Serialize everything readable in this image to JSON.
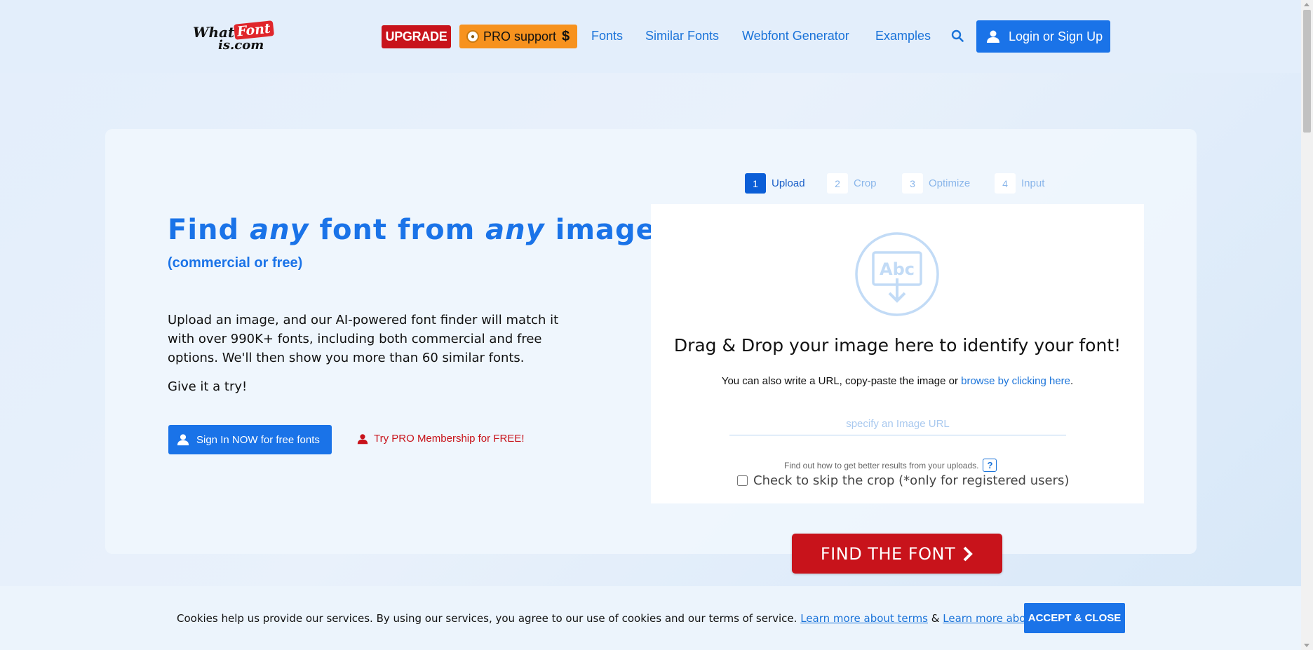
{
  "header": {
    "logo": {
      "what": "What",
      "font": "Font",
      "iscom": "is.com"
    },
    "upgrade_label": "UPGRADE",
    "pro_support_label": "PRO support",
    "pro_support_symbol": "$",
    "nav": [
      {
        "label": "Fonts"
      },
      {
        "label": "Similar Fonts"
      },
      {
        "label": "Webfont Generator"
      },
      {
        "label": "Examples"
      }
    ],
    "login_label": "Login or Sign Up"
  },
  "hero": {
    "title_parts": [
      "Find ",
      "any",
      " font from ",
      "any",
      " image"
    ],
    "subtitle": "(commercial or free)",
    "description": "Upload an image, and our AI-powered font finder will match it with over 990K+ fonts, including both commercial and free options. We'll then show you more than 60 similar fonts.",
    "try_text": "Give it a try!",
    "signin_label": "Sign In NOW for free fonts",
    "try_pro_label": "Try PRO Membership for FREE!"
  },
  "steps": [
    {
      "num": "1",
      "label": "Upload",
      "active": true
    },
    {
      "num": "2",
      "label": "Crop",
      "active": false
    },
    {
      "num": "3",
      "label": "Optimize",
      "active": false
    },
    {
      "num": "4",
      "label": "Input",
      "active": false
    }
  ],
  "upload": {
    "icon_text": "Abc",
    "title": "Drag & Drop your image here to identify your font!",
    "sub_prefix": "You can also write a URL, copy-paste the image or ",
    "sub_link": "browse by clicking here",
    "sub_suffix": ".",
    "url_placeholder": "specify an Image URL",
    "url_value": "",
    "tip_text": "Find out how to get better results from your uploads.",
    "tip_help": "?",
    "skip_label": "Check to skip the crop (*only for registered users)",
    "skip_checked": false,
    "find_label": "FIND THE FONT"
  },
  "cookie": {
    "text": "Cookies help us provide our services. By using our services, you agree to our use of cookies and our terms of service.",
    "terms_link": "Learn more about terms",
    "amp": "&",
    "cookie_link": "Learn more about cookie",
    "accept_label": "ACCEPT & CLOSE"
  },
  "colors": {
    "accent": "#1a73e8",
    "red": "#c8131b",
    "orange": "#f7921e"
  }
}
